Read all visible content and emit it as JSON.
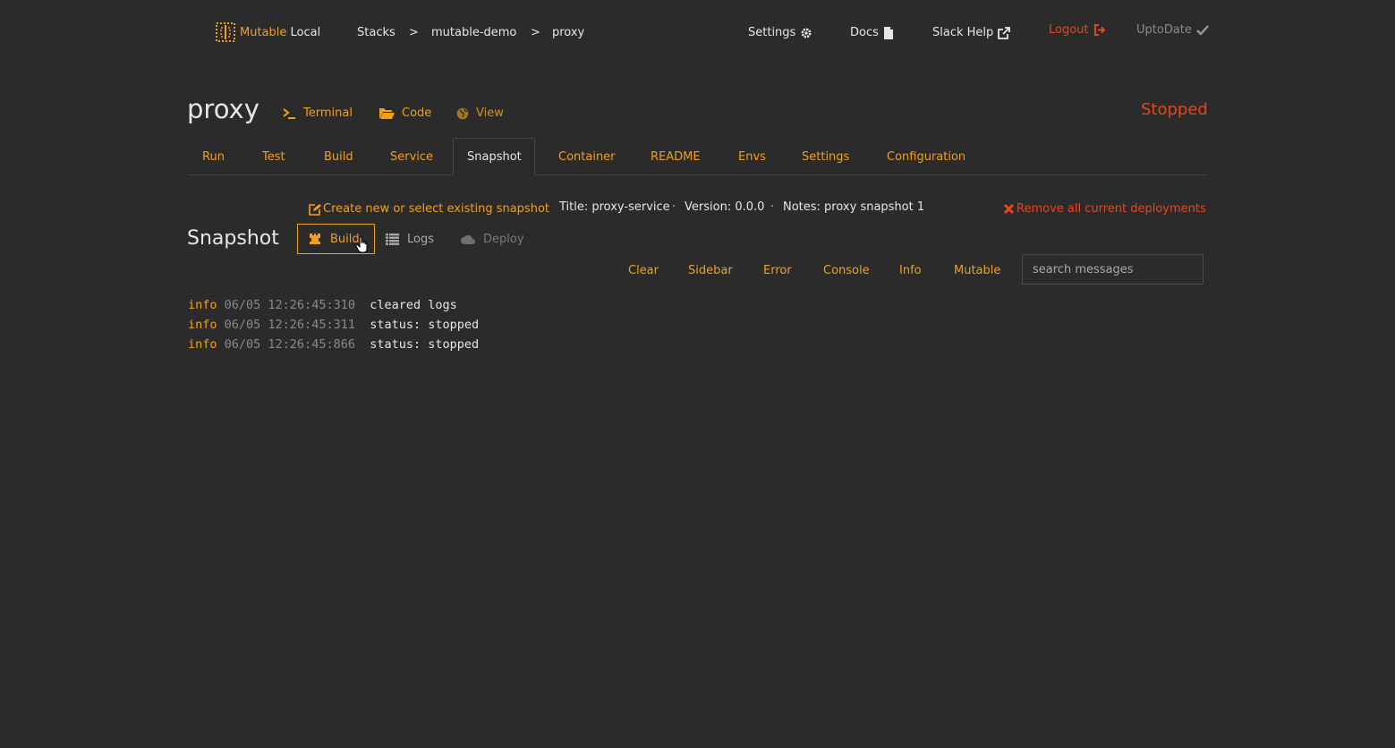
{
  "brand": {
    "name_accent": "Mutable",
    "name_rest": "Local"
  },
  "breadcrumb": {
    "items": [
      "Stacks",
      "mutable-demo",
      "proxy"
    ],
    "separator": ">"
  },
  "topnav": {
    "settings": "Settings",
    "docs": "Docs",
    "slack_help": "Slack Help",
    "logout": "Logout",
    "update_status": "UptoDate"
  },
  "header": {
    "title": "proxy",
    "links": {
      "terminal": "Terminal",
      "code": "Code",
      "view": "View"
    },
    "status": "Stopped"
  },
  "tabs": [
    {
      "label": "Run"
    },
    {
      "label": "Test"
    },
    {
      "label": "Build"
    },
    {
      "label": "Service"
    },
    {
      "label": "Snapshot",
      "active": true
    },
    {
      "label": "Container"
    },
    {
      "label": "README"
    },
    {
      "label": "Envs"
    },
    {
      "label": "Settings"
    },
    {
      "label": "Configuration"
    }
  ],
  "snapshot": {
    "create_link": "Create new or select existing snapshot",
    "title": "Title: proxy-service",
    "version": "Version: 0.0.0",
    "notes": "Notes: proxy snapshot 1",
    "separator": "·",
    "remove_link": "Remove all current deployments",
    "heading": "Snapshot",
    "actions": {
      "build": "Build",
      "logs": "Logs",
      "deploy": "Deploy"
    }
  },
  "filters": [
    "Clear",
    "Sidebar",
    "Error",
    "Console",
    "Info",
    "Mutable"
  ],
  "search": {
    "placeholder": "search messages",
    "value": ""
  },
  "logs": [
    {
      "level": "info",
      "timestamp": "06/05 12:26:45:310",
      "message": "cleared logs"
    },
    {
      "level": "info",
      "timestamp": "06/05 12:26:45:311",
      "message": "status: stopped"
    },
    {
      "level": "info",
      "timestamp": "06/05 12:26:45:866",
      "message": "status: stopped"
    }
  ],
  "icons": {
    "logo": "mutable-logo-icon",
    "settings": "gear-icon",
    "docs": "file-icon",
    "slack_help": "external-link-icon",
    "logout": "sign-out-icon",
    "update_status": "check-icon",
    "terminal": "terminal-icon",
    "code": "folder-open-icon",
    "view": "globe-icon",
    "create": "edit-icon",
    "remove": "close-icon",
    "build": "rook-icon",
    "logs": "list-icon",
    "deploy": "cloud-icon"
  },
  "colors": {
    "background": "#2a2b2a",
    "accent": "#f0a020",
    "danger": "#e8451e",
    "text": "#e6e6e6",
    "muted": "#8a8a8a"
  }
}
